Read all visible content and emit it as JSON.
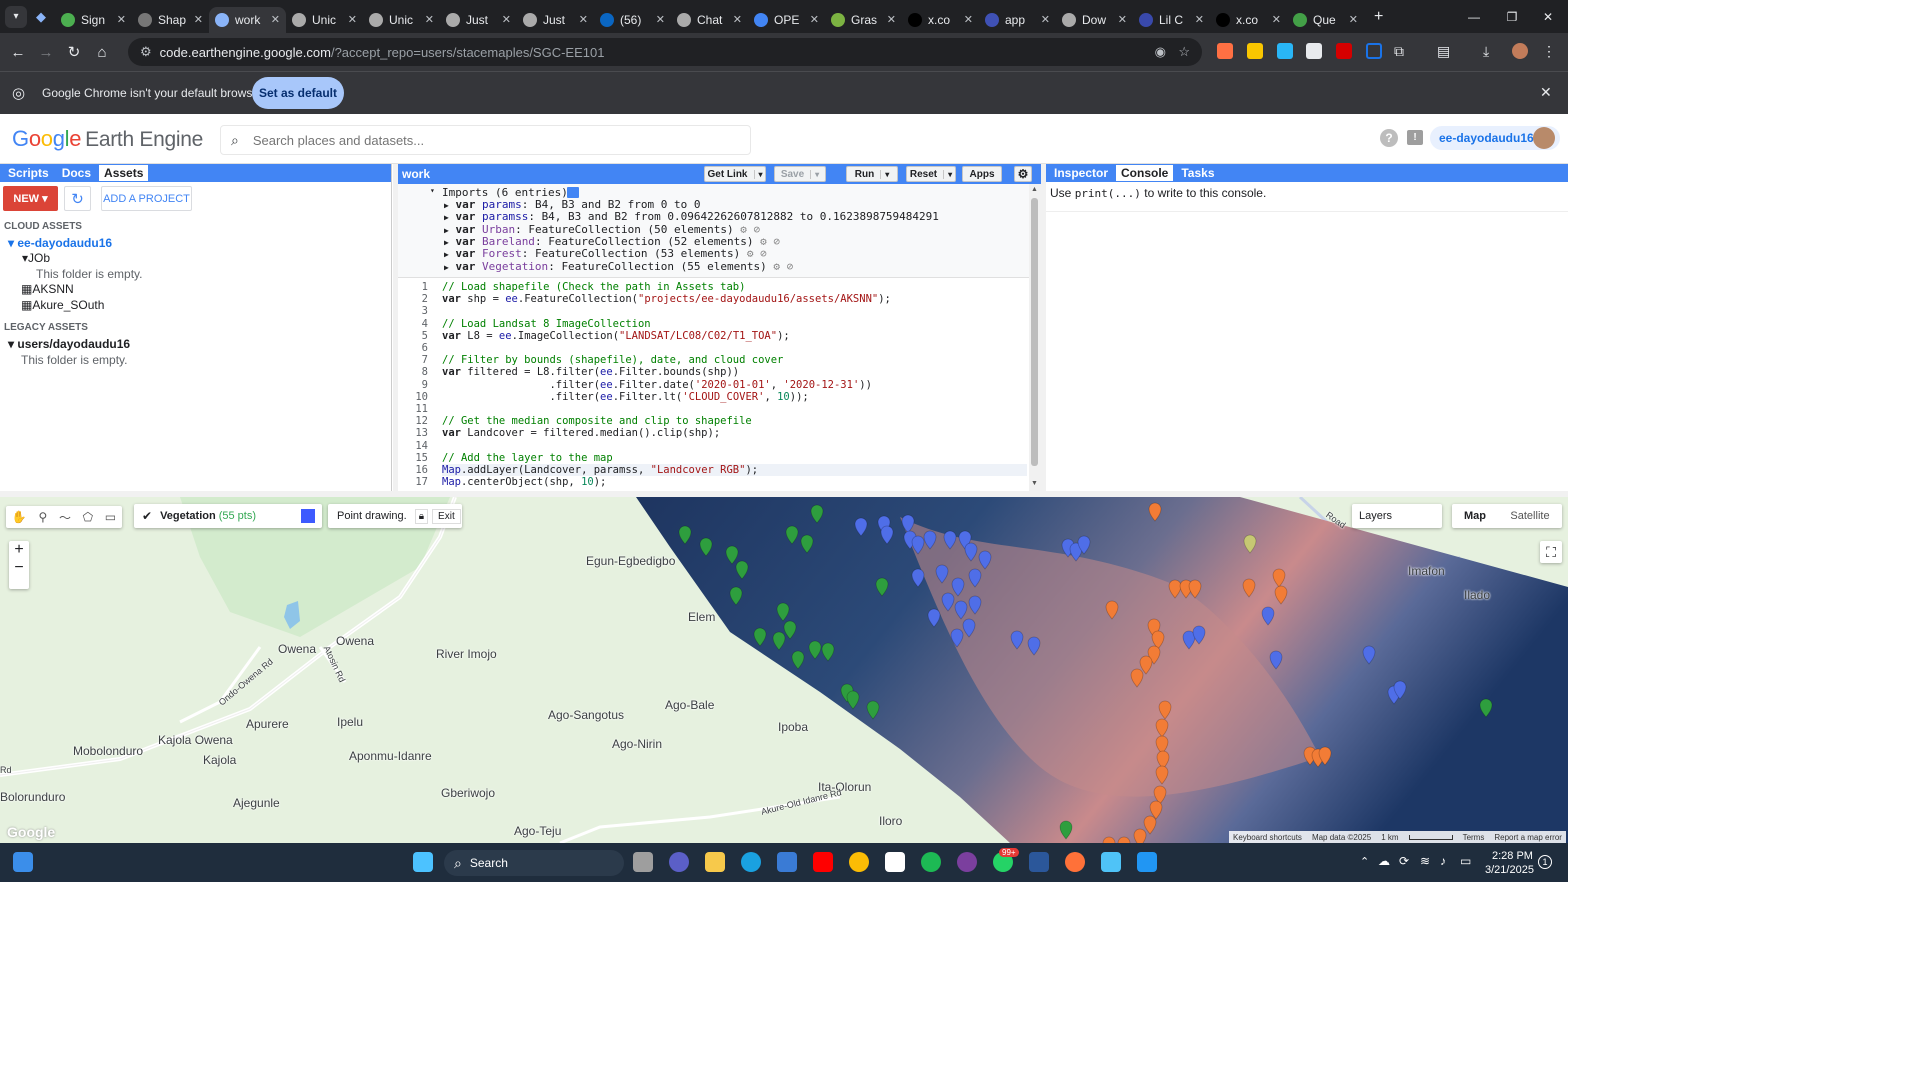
{
  "browser": {
    "tabs": [
      {
        "label": "Sign",
        "color": "#4caf50"
      },
      {
        "label": "Shap",
        "color": "#777"
      },
      {
        "label": "work",
        "color": "#8ab4f8",
        "active": true
      },
      {
        "label": "Unic",
        "color": "#aaa"
      },
      {
        "label": "Unic",
        "color": "#aaa"
      },
      {
        "label": "Just",
        "color": "#aaa"
      },
      {
        "label": "Just",
        "color": "#aaa"
      },
      {
        "label": "(56)",
        "color": "#0a66c2"
      },
      {
        "label": "Chat",
        "color": "#aaa"
      },
      {
        "label": "OPE",
        "color": "#4285f4"
      },
      {
        "label": "Gras",
        "color": "#7cb342"
      },
      {
        "label": "x.co",
        "color": "#000"
      },
      {
        "label": "app",
        "color": "#3f51b5"
      },
      {
        "label": "Dow",
        "color": "#aaa"
      },
      {
        "label": "Lil C",
        "color": "#3949ab"
      },
      {
        "label": "x.co",
        "color": "#000"
      },
      {
        "label": "Que",
        "color": "#43a047"
      }
    ],
    "url_host": "code.earthengine.google.com",
    "url_path": "/?accept_repo=users/stacemaples/SGC-EE101",
    "infobar_text": "Google Chrome isn't your default browser",
    "set_default_label": "Set as default"
  },
  "gee": {
    "logo_google": "Google",
    "logo_product": "Earth Engine",
    "search_placeholder": "Search places and datasets...",
    "username": "ee-dayodaudu16"
  },
  "left_panel": {
    "tabs": [
      "Scripts",
      "Docs",
      "Assets"
    ],
    "active_tab": "Assets",
    "new_label": "NEW",
    "add_project_label": "ADD A PROJECT",
    "cloud_assets_header": "CLOUD ASSETS",
    "project_name": "ee-dayodaudu16",
    "folder_name": "JOb",
    "empty_folder_text": "This folder is empty.",
    "assets": [
      "AKSNN",
      "Akure_SOuth"
    ],
    "legacy_header": "LEGACY ASSETS",
    "legacy_user": "users/dayodaudu16",
    "legacy_empty_text": "This folder is empty."
  },
  "editor": {
    "script_name": "work",
    "buttons": {
      "get_link": "Get Link",
      "save": "Save",
      "run": "Run",
      "reset": "Reset",
      "apps": "Apps"
    },
    "imports_header": "Imports (6 entries)",
    "imports": [
      {
        "name": "params",
        "desc": "B4, B3 and B2 from 0 to 0"
      },
      {
        "name": "paramss",
        "desc": "B4, B3 and B2 from 0.09642262607812882 to 0.1623898759484291"
      },
      {
        "name": "Urban",
        "desc": "FeatureCollection (50 elements)"
      },
      {
        "name": "Bareland",
        "desc": "FeatureCollection (52 elements)"
      },
      {
        "name": "Forest",
        "desc": "FeatureCollection (53 elements)"
      },
      {
        "name": "Vegetation",
        "desc": "FeatureCollection (55 elements)"
      }
    ],
    "lines": [
      "// Load shapefile (Check the path in Assets tab)",
      "var shp = ee.FeatureCollection(\"projects/ee-dayodaudu16/assets/AKSNN\");",
      "",
      "// Load Landsat 8 ImageCollection",
      "var L8 = ee.ImageCollection(\"LANDSAT/LC08/C02/T1_TOA\");",
      "",
      "// Filter by bounds (shapefile), date, and cloud cover",
      "var filtered = L8.filter(ee.Filter.bounds(shp))",
      "                 .filter(ee.Filter.date('2020-01-01', '2020-12-31'))",
      "                 .filter(ee.Filter.lt('CLOUD_COVER', 10));",
      "",
      "// Get the median composite and clip to shapefile",
      "var Landcover = filtered.median().clip(shp);",
      "",
      "// Add the layer to the map",
      "Map.addLayer(Landcover, paramss, \"Landcover RGB\");",
      "Map.centerObject(shp, 10);"
    ],
    "line_numbers": [
      "1",
      "2",
      "3",
      "4",
      "5",
      "6",
      "7",
      "8",
      "9",
      "10",
      "11",
      "12",
      "13",
      "14",
      "15",
      "16",
      "17"
    ]
  },
  "right_panel": {
    "tabs": [
      "Inspector",
      "Console",
      "Tasks"
    ],
    "active_tab": "Console",
    "console_pre": "Use ",
    "console_code": "print(...)",
    "console_post": " to write to this console."
  },
  "map": {
    "layer_name": "Vegetation",
    "layer_count": "(55 pts)",
    "layer_color": "#3d5afe",
    "drawing_label": "Point drawing.",
    "exit_label": "Exit",
    "layers_label": "Layers",
    "map_label": "Map",
    "satellite_label": "Satellite",
    "places": [
      "Egun-Egbedigbo",
      "Elem",
      "Owena",
      "Owena",
      "River Imojo",
      "Apurere",
      "Ipelu",
      "Ago-Sangotus",
      "Ago-Bale",
      "Ago-Nirin",
      "Ipoba",
      "Mobolonduro",
      "Kajola Owena",
      "Kajola",
      "Aponmu-Idanre",
      "Bolorunduro",
      "Ajegunle",
      "Gberiwojo",
      "Ita-Olorun",
      "Ago-Teju",
      "Iloro",
      "Imafon",
      "Ilado"
    ],
    "roads": [
      "Ondo-Owena Rd",
      "Atosin Rd",
      "Akure-Old Idanre Rd",
      "Road",
      "Rd"
    ],
    "attribution": [
      "Keyboard shortcuts",
      "Map data ©2025",
      "1 km",
      "Terms",
      "Report a map error"
    ],
    "google_mark": "Google"
  },
  "taskbar": {
    "search_label": "Search",
    "time": "2:28 PM",
    "date": "3/21/2025",
    "badge": "99+",
    "notif_count": "1"
  }
}
